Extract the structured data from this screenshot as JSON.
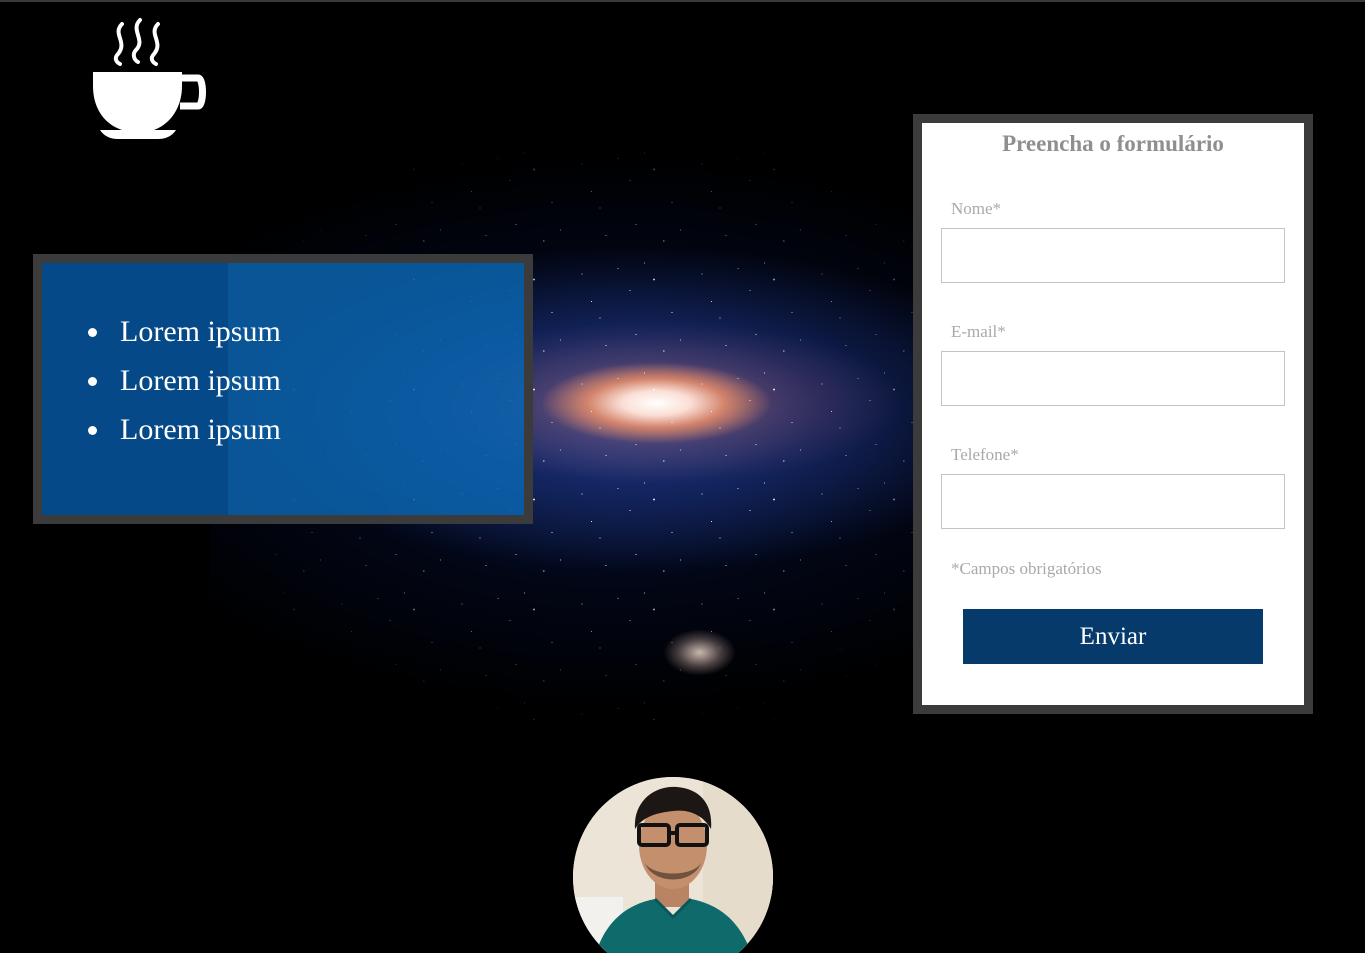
{
  "logo": {
    "icon": "coffee-cup-icon"
  },
  "list": {
    "items": [
      "Lorem ipsum",
      "Lorem ipsum",
      "Lorem ipsum"
    ]
  },
  "form": {
    "title": "Preencha o formulário",
    "fields": [
      {
        "label": "Nome*",
        "value": ""
      },
      {
        "label": "E-mail*",
        "value": ""
      },
      {
        "label": "Telefone*",
        "value": ""
      }
    ],
    "required_note": "*Campos obrigatórios",
    "submit_label": "Enviar"
  },
  "colors": {
    "background": "#000000",
    "frame": "#3b3b3b",
    "list_panel": "#0a64af",
    "button": "#053a6b",
    "label_text": "#a9a9a9"
  },
  "avatar": {
    "icon": "profile-photo"
  }
}
